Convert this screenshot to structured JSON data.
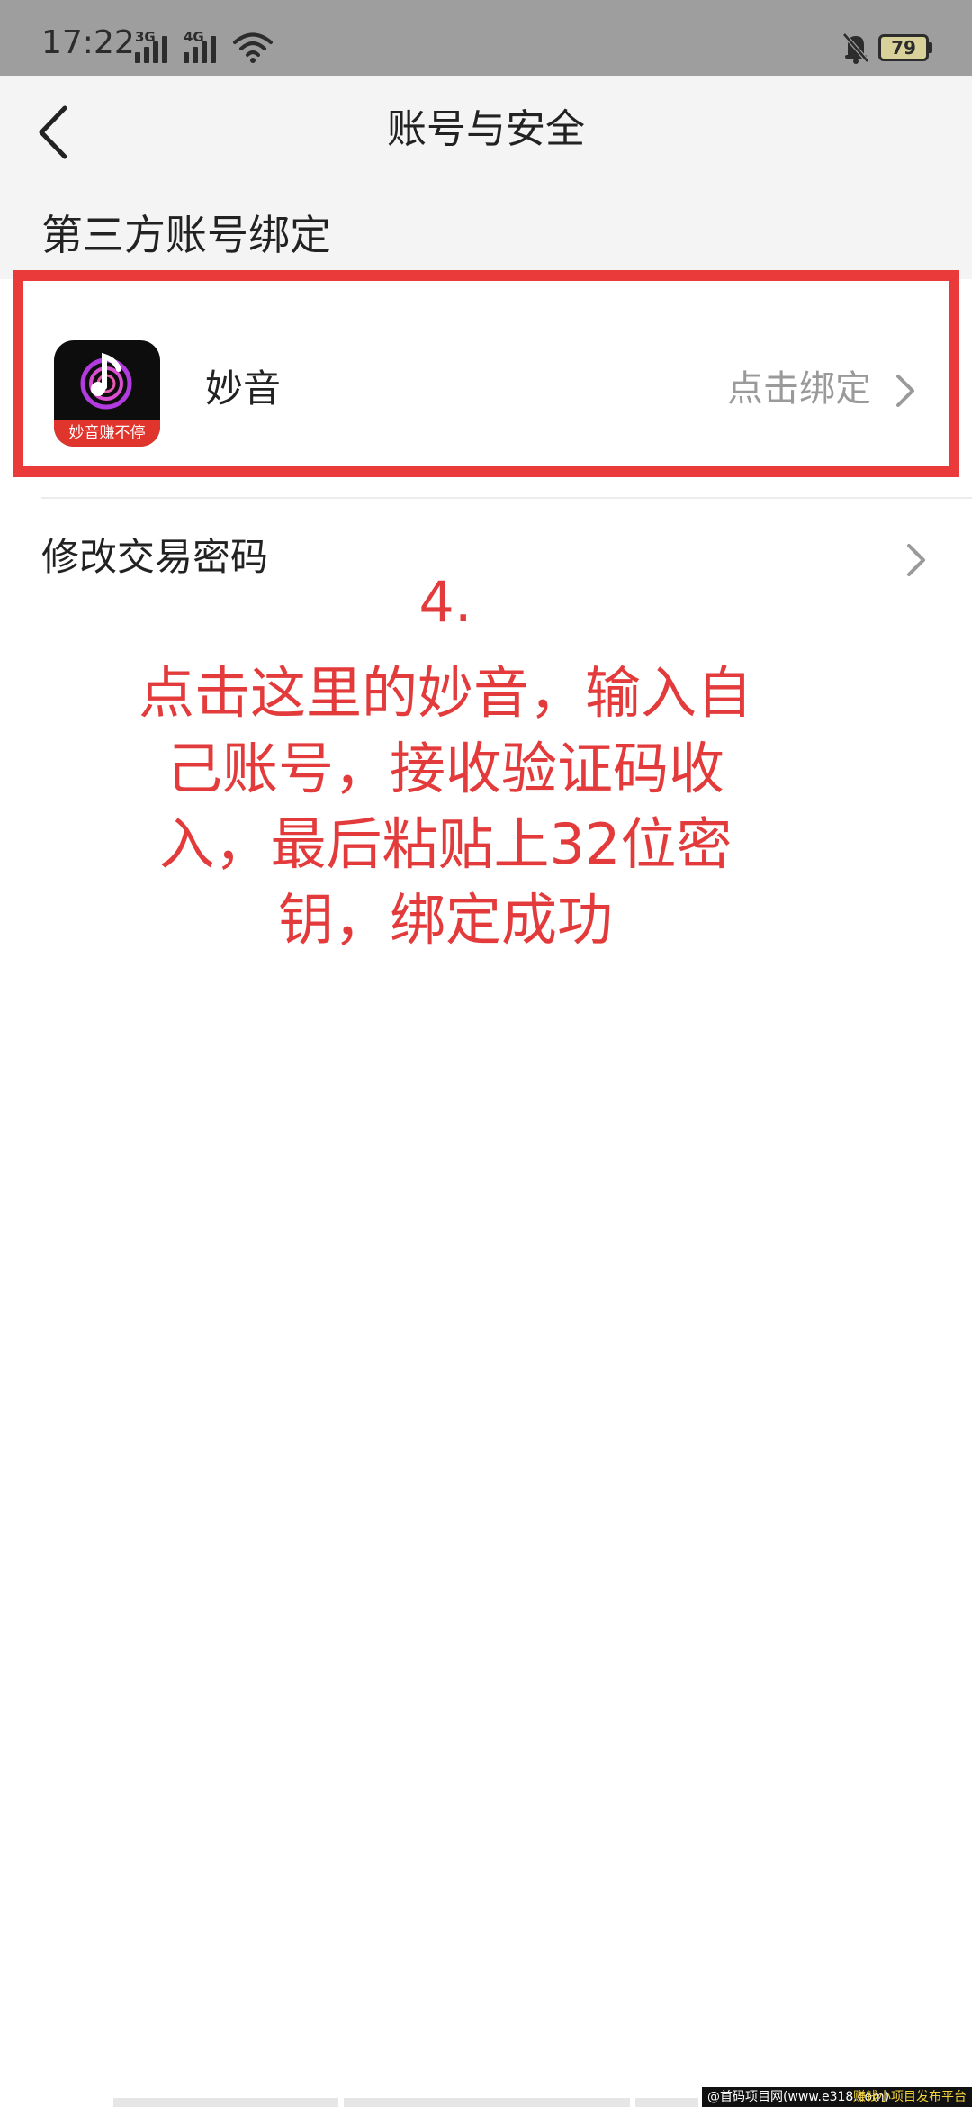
{
  "status_bar": {
    "time": "17:22",
    "signal_1_label": "3G",
    "signal_2_label": "4G",
    "battery_level": "79"
  },
  "header": {
    "title": "账号与安全"
  },
  "section": {
    "title": "第三方账号绑定"
  },
  "binding": {
    "app_name": "妙音",
    "app_icon_caption": "妙音赚不停",
    "action_label": "点击绑定"
  },
  "settings": {
    "change_trade_password": "修改交易密码"
  },
  "annotation": {
    "step": "4.",
    "lines": [
      "点击这里的妙音，输入自",
      "己账号，接收验证码收",
      "入，最后粘贴上32位密",
      "钥，绑定成功"
    ]
  },
  "footer": {
    "watermark_left": "@首码项目网(www.e318.com)",
    "watermark_right": "赚钱小项目发布平台"
  },
  "colors": {
    "annotation_red": "#e33b3b",
    "highlight_border": "#ea3a3a",
    "status_bar_bg": "#9e9e9e",
    "header_bg": "#f4f4f4"
  },
  "icons": {
    "back": "chevron-left-icon",
    "row_arrow": "chevron-right-icon",
    "wifi": "wifi-icon",
    "mute": "bell-off-icon",
    "app": "music-note-icon"
  }
}
